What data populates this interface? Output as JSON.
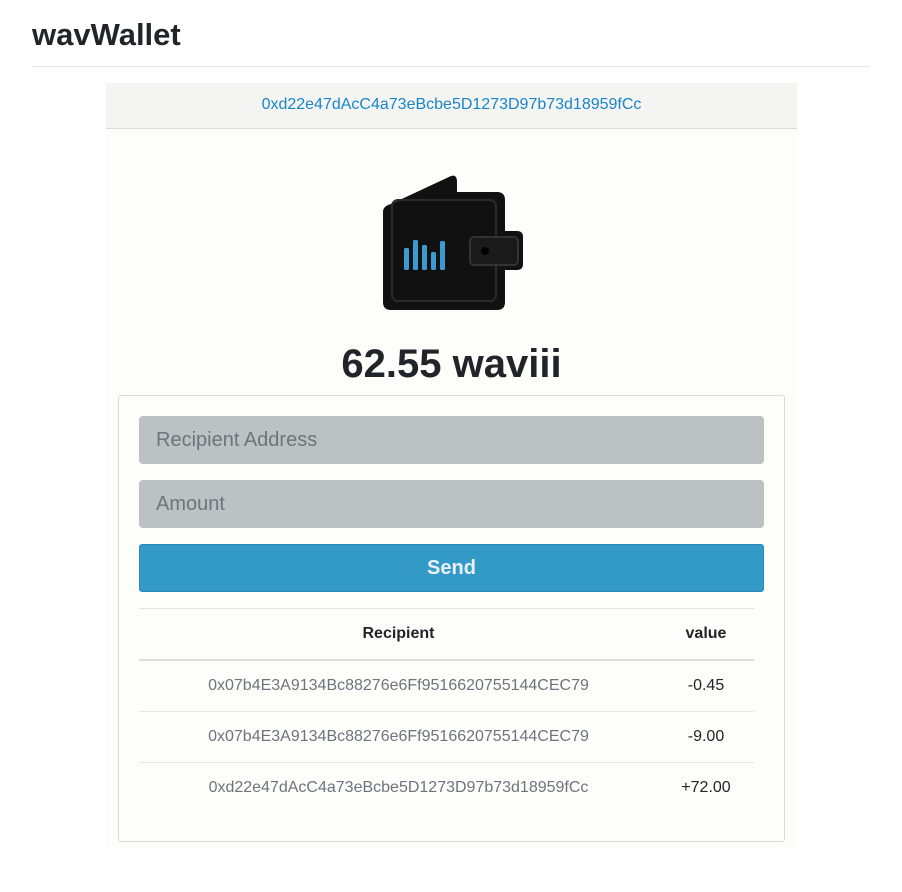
{
  "app": {
    "title": "wavWallet"
  },
  "wallet": {
    "address": "0xd22e47dAcC4a73eBcbe5D1273D97b73d18959fCc",
    "balance_text": "62.55 waviii",
    "icon": "wallet-icon"
  },
  "form": {
    "recipient_placeholder": "Recipient Address",
    "amount_placeholder": "Amount",
    "send_label": "Send"
  },
  "table": {
    "headers": {
      "recipient": "Recipient",
      "value": "value"
    },
    "rows": [
      {
        "recipient": "0x07b4E3A9134Bc88276e6Ff9516620755144CEC79",
        "value": "-0.45"
      },
      {
        "recipient": "0x07b4E3A9134Bc88276e6Ff9516620755144CEC79",
        "value": "-9.00"
      },
      {
        "recipient": "0xd22e47dAcC4a73eBcbe5D1273D97b73d18959fCc",
        "value": "+72.00"
      }
    ]
  },
  "colors": {
    "accent_blue": "#3399c7",
    "link_blue": "#1a85c8",
    "input_gray": "#bcc1c4",
    "wallet_dark": "#111111"
  }
}
